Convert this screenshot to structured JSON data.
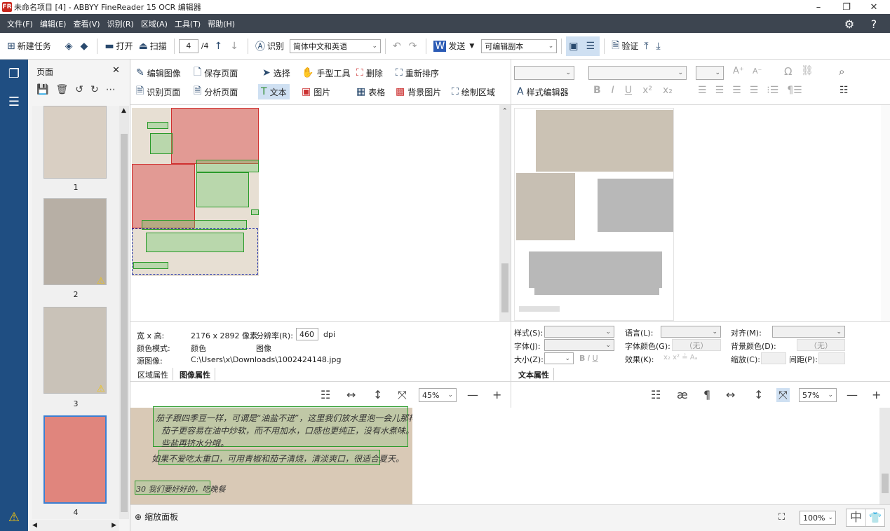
{
  "app": {
    "title": "未命名项目 [4] - ABBYY FineReader 15 OCR 编辑器",
    "icon": "abbyy-icon"
  },
  "menu": [
    "文件(F)",
    "编辑(E)",
    "查看(V)",
    "识别(R)",
    "区域(A)",
    "工具(T)",
    "帮助(H)"
  ],
  "toolbar": {
    "new_task": "新建任务",
    "open": "打开",
    "scan": "扫描",
    "page_current": "4",
    "page_total": "/4",
    "recognize": "识别",
    "language": "简体中文和英语",
    "send": "发送",
    "output": "可编辑副本",
    "verify": "验证"
  },
  "pages_panel": {
    "title": "页面",
    "thumbs": [
      {
        "label": "1",
        "warning": false,
        "selected": false
      },
      {
        "label": "2",
        "warning": true,
        "selected": false
      },
      {
        "label": "3",
        "warning": true,
        "selected": false
      },
      {
        "label": "4",
        "warning": false,
        "selected": true
      }
    ]
  },
  "image_tools": {
    "edit_image": "编辑图像",
    "save_page": "保存页面",
    "select": "选择",
    "hand_tool": "手型工具",
    "delete": "删除",
    "reorder": "重新排序",
    "recognize_page": "识别页面",
    "analyze_page": "分析页面",
    "text": "文本",
    "picture": "图片",
    "table": "表格",
    "background_picture": "背景图片",
    "draw_area": "绘制区域"
  },
  "text_tools": {
    "style_editor": "样式编辑器"
  },
  "image_props": {
    "size_label": "宽 x 高:",
    "size_value": "2176 x 2892 像素",
    "res_label": "分辨率(R):",
    "res_value": "460",
    "res_unit": "dpi",
    "color_label": "颜色模式:",
    "color_value": "颜色",
    "type_value": "图像",
    "source_label": "源图像:",
    "source_value": "C:\\Users\\x\\Downloads\\1002424148.jpg",
    "tab_area": "区域属性",
    "tab_image": "图像属性"
  },
  "text_props": {
    "style": "样式(S):",
    "language": "语言(L):",
    "align": "对齐(M):",
    "font": "字体(J):",
    "font_color": "字体颜色(G):",
    "font_color_value": "（无）",
    "bg_color": "背景颜色(D):",
    "bg_color_value": "（无）",
    "size": "大小(Z):",
    "effect": "效果(K):",
    "scale": "缩放(C):",
    "spacing": "间距(P):",
    "tab_text": "文本属性"
  },
  "zoom": {
    "image_zoom": "45%",
    "text_zoom": "57%",
    "status_zoom": "100%",
    "zoom_panel": "缩放面板"
  },
  "zoom_text": {
    "line1": "茄子跟四季豆一样，可谓是“油盐不进”，这里我们放水里泡一会儿那样",
    "line2": "茄子更容易在油中炒软，而不用加水，口感也更纯正，没有水煮味。留",
    "line3": "些盐再挤水分哦。",
    "line4": "如果不爱吃太重口，可用青椒和茄子清烧，清淡爽口，很适合夏天。",
    "line5": "30 我们要好好的，吃晚餐"
  },
  "status": {
    "ime": "中"
  },
  "colors": {
    "menubar": "#3d4550",
    "rail": "#1f4e82",
    "selected_thumb": "#3b7fd1"
  }
}
